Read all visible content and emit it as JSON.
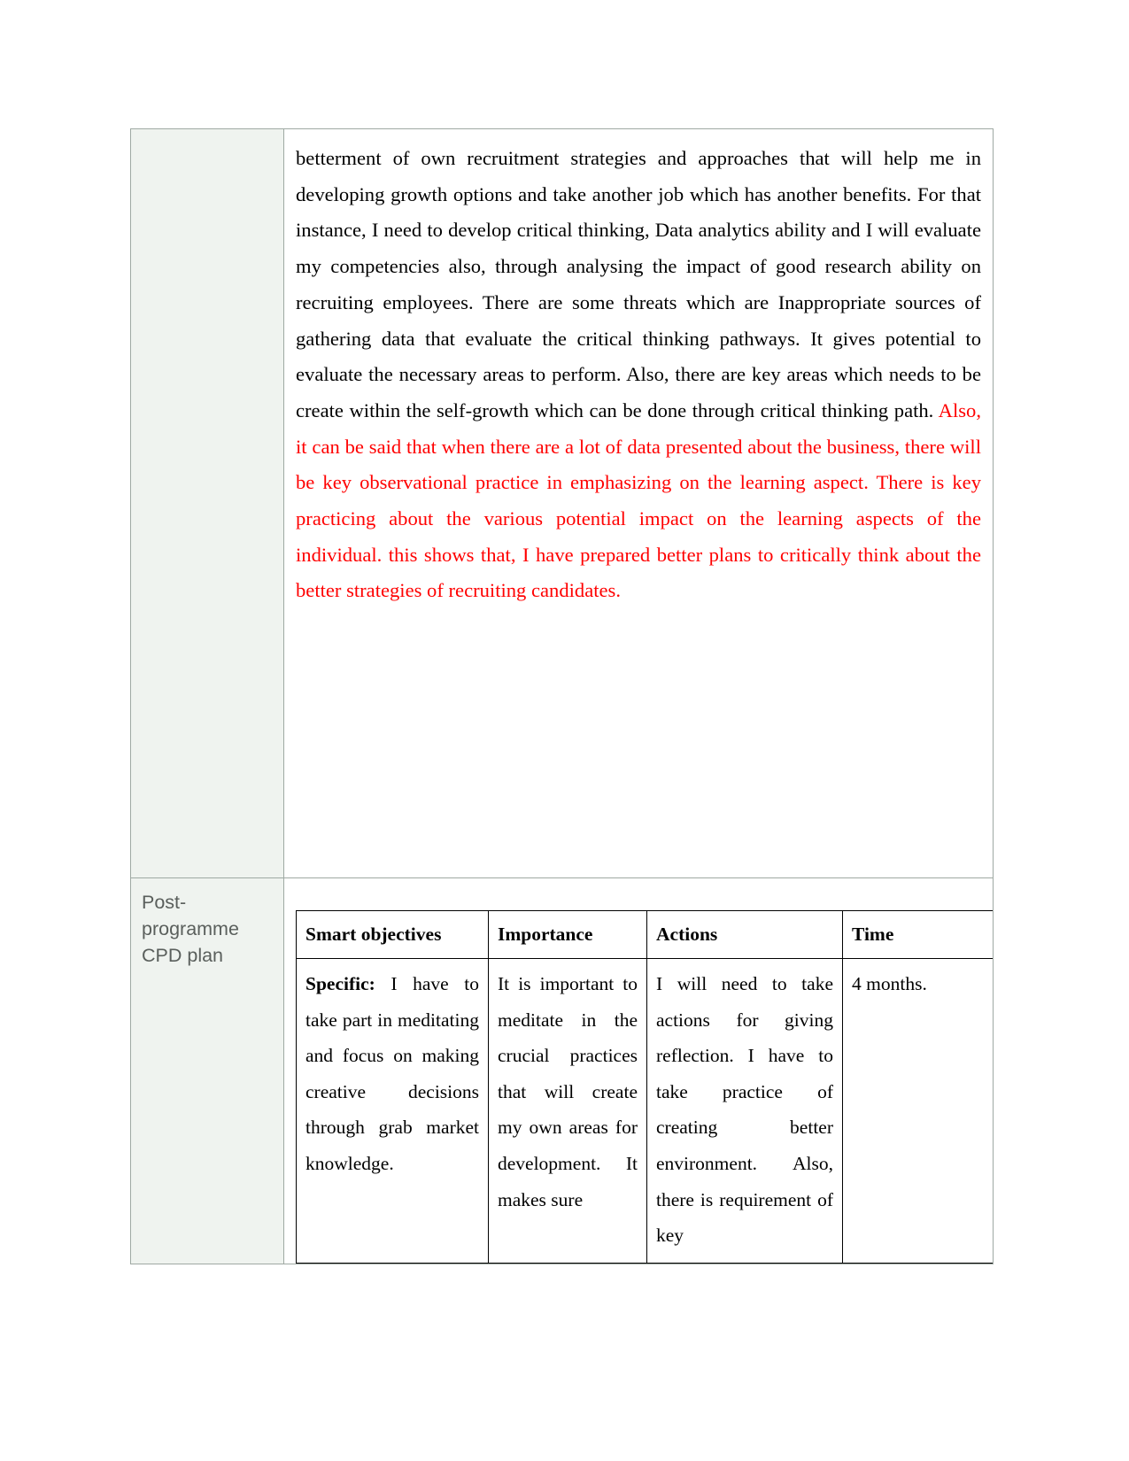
{
  "document": {
    "page_background": "#ffffff",
    "label_column_background": "#eff3ef",
    "border_color": "#9fa9a3",
    "highlight_color": "#ff0000"
  },
  "rows": [
    {
      "label": "",
      "paragraph": {
        "black_text": "betterment of own recruitment strategies and approaches that will help me in developing growth options and take another job which has another benefits. For that instance, I need to develop critical thinking, Data analytics ability and I will evaluate my competencies also, through analysing the impact of good research ability on recruiting employees. There are some threats which are Inappropriate sources of gathering data that evaluate the critical thinking pathways. It gives potential to evaluate the necessary areas to perform. Also, there are key areas which needs to be create within the self-growth which can be done through critical thinking path. ",
        "red_text": "Also, it can be said that when there are a lot of data presented about the business, there will be key observational practice in emphasizing on the learning aspect. There is key practicing about the various potential impact on the learning aspects of the individual. this shows that, I have prepared better plans to critically think about the better strategies of recruiting candidates."
      }
    },
    {
      "label": "Post-programme CPD plan"
    }
  ],
  "smart_table": {
    "headers": [
      "Smart objectives",
      "Importance",
      "Actions",
      "Time"
    ],
    "rows": [
      {
        "objective_lead": "Specific:",
        "objective": " I have to take part in meditating and focus on making creative decisions through grab market knowledge.",
        "importance": "It is important to meditate in the crucial practices that will create my own areas for development. It makes sure",
        "actions": "I will need to take actions for giving reflection. I have to take practice of creating better environment. Also, there is requirement of key",
        "time": "4 months."
      }
    ]
  }
}
